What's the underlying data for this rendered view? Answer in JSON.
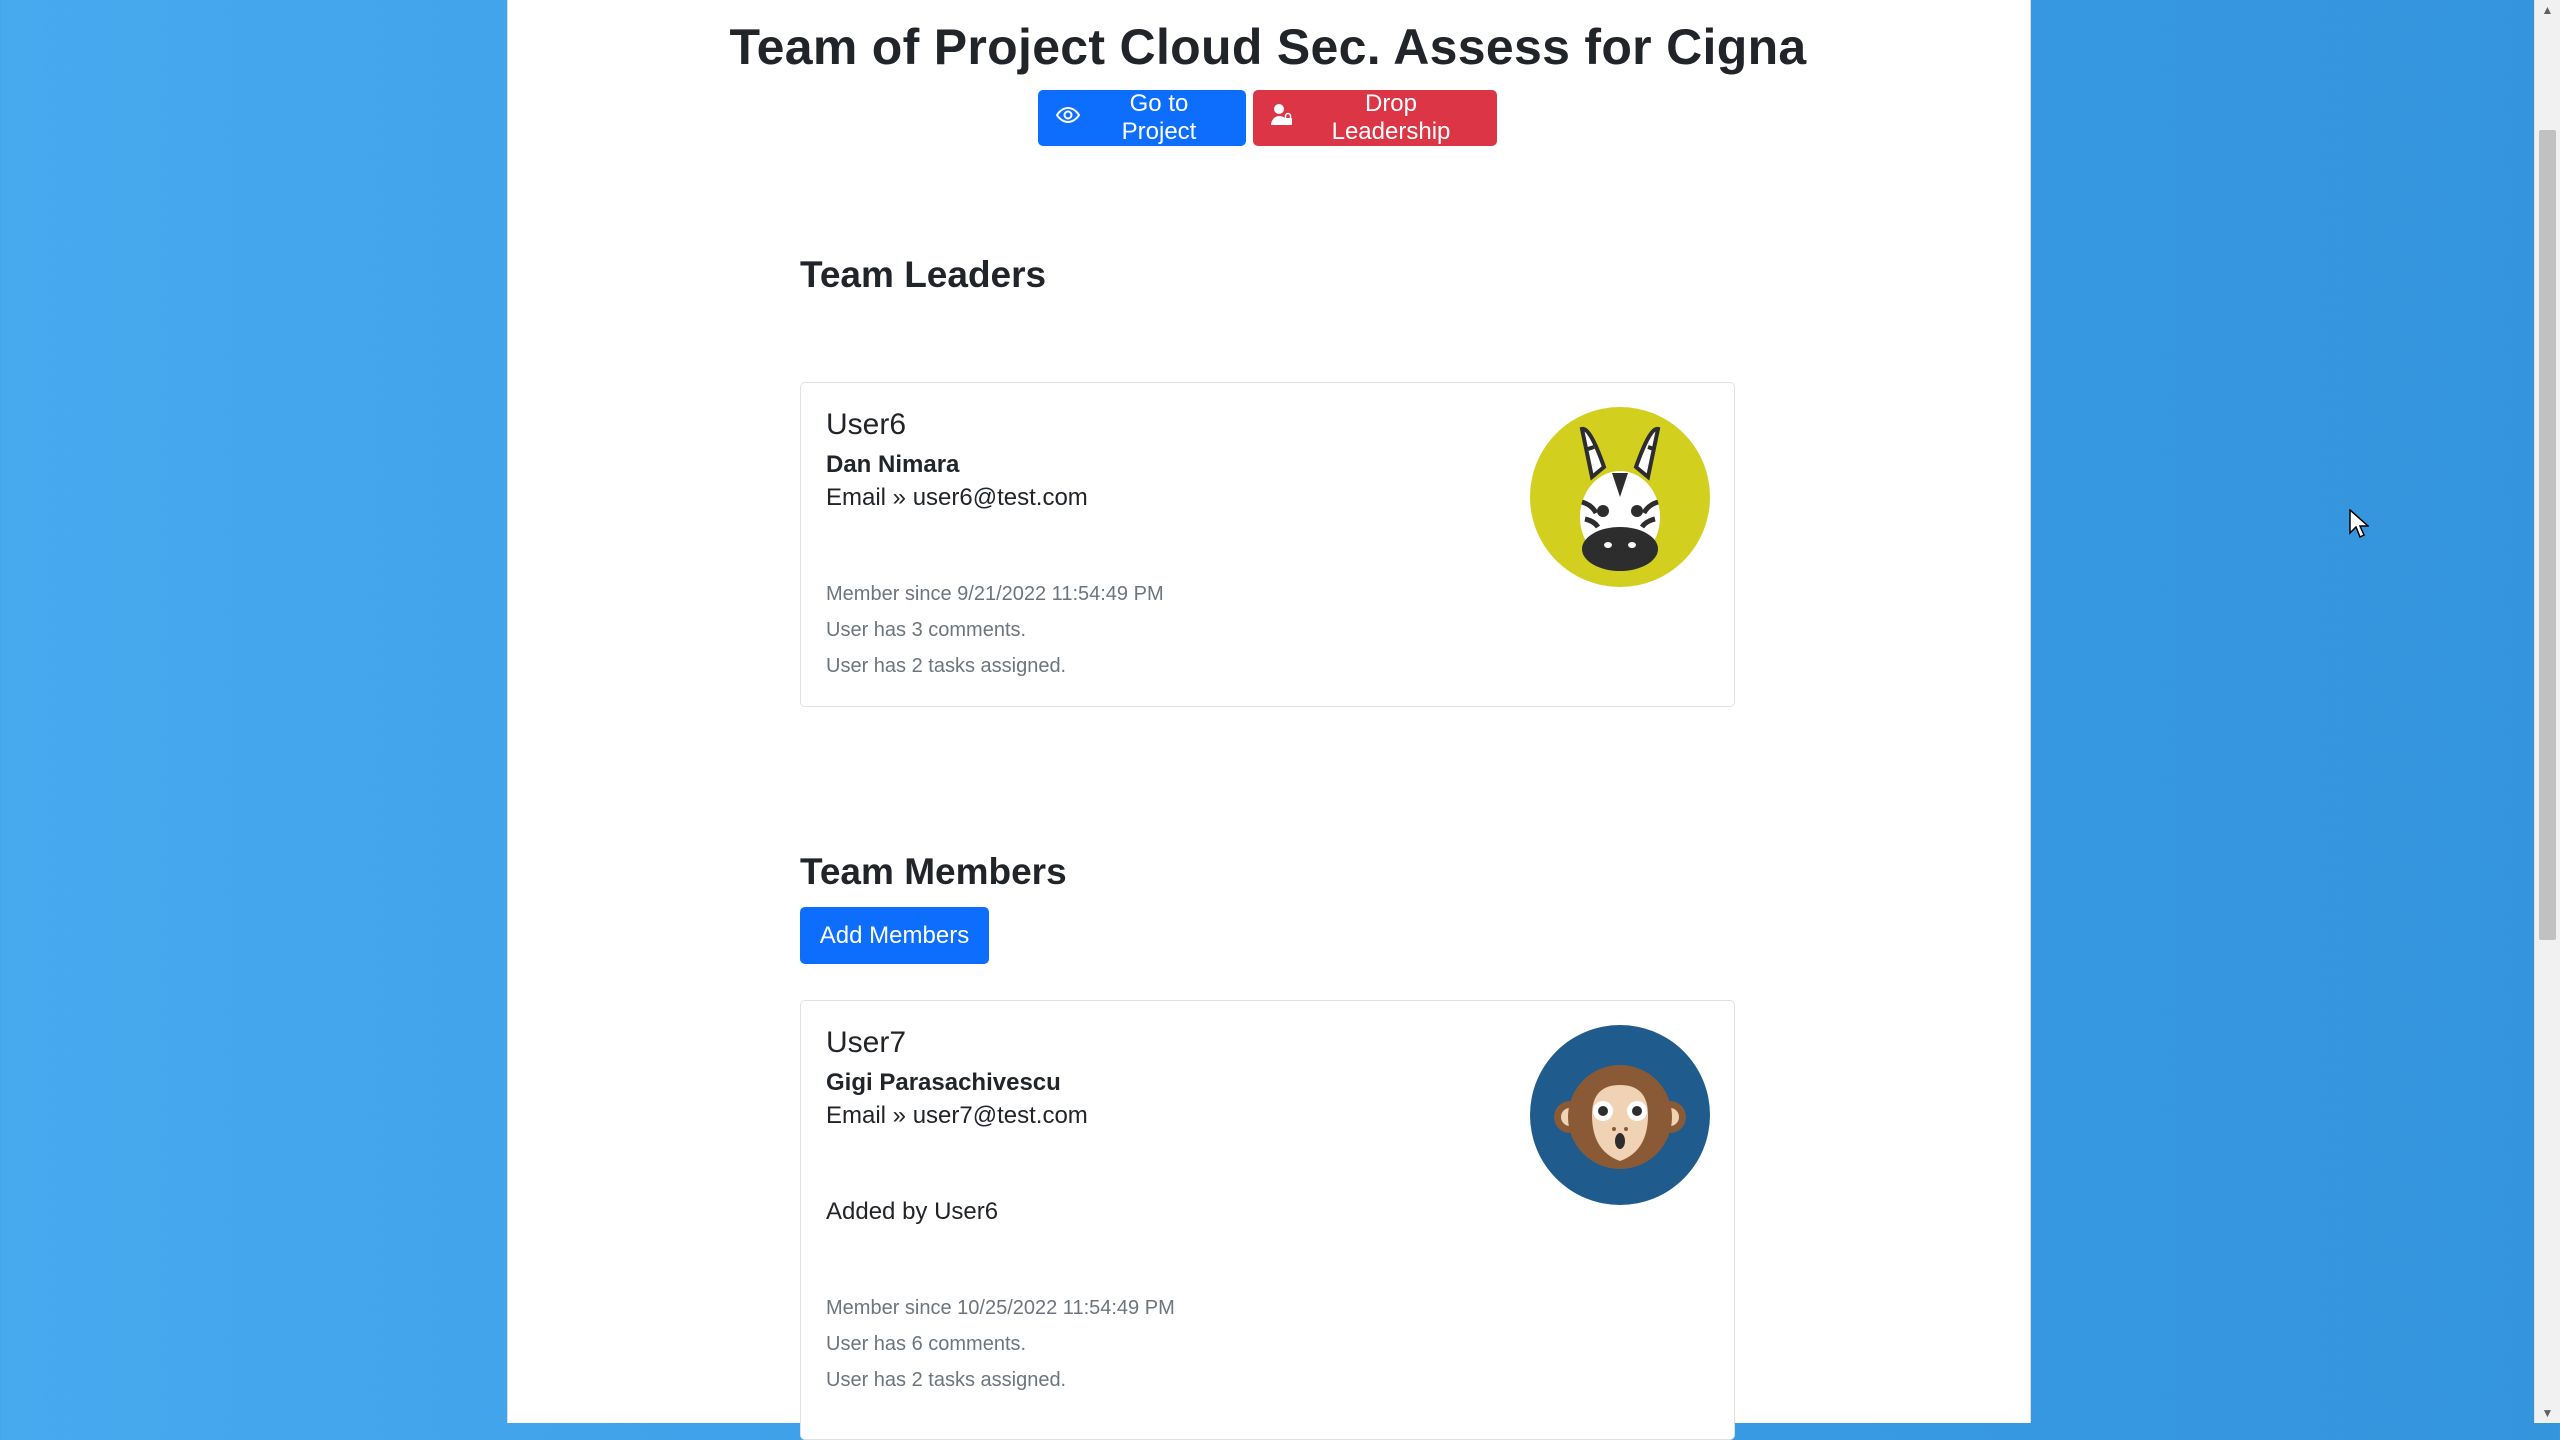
{
  "page": {
    "title": "Team of Project Cloud Sec. Assess for Cigna"
  },
  "actions": {
    "go_to_project": {
      "label": "Go to Project",
      "icon": "eye-icon"
    },
    "drop_leadership": {
      "label": "Drop Leadership",
      "icon": "user-lock-icon"
    }
  },
  "leaders": {
    "heading": "Team Leaders",
    "items": [
      {
        "username": "User6",
        "full_name": "Dan Nimara",
        "email": "Email » user6@test.com",
        "member_since": "Member since 9/21/2022 11:54:49 PM",
        "comments": "User has 3 comments.",
        "tasks": "User has 2 tasks assigned.",
        "avatar": "zebra-avatar",
        "avatar_bg": "#d2cf1f"
      }
    ]
  },
  "members": {
    "heading": "Team Members",
    "add_label": "Add Members",
    "items": [
      {
        "username": "User7",
        "full_name": "Gigi Parasachivescu",
        "email": "Email » user7@test.com",
        "added_by": "Added by User6",
        "member_since": "Member since 10/25/2022 11:54:49 PM",
        "comments": "User has 6 comments.",
        "tasks": "User has 2 tasks assigned.",
        "avatar": "monkey-avatar",
        "avatar_bg": "#1f5b8c"
      }
    ]
  },
  "colors": {
    "primary": "#0d6efd",
    "danger": "#dc3545",
    "background": "#3fa2ea"
  }
}
